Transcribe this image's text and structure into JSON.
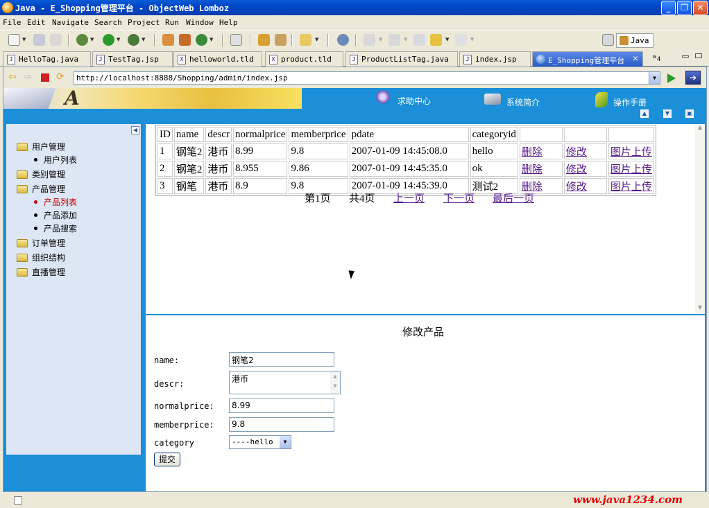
{
  "window": {
    "title": "Java - E_Shopping管理平台 - ObjectWeb Lomboz"
  },
  "menu": [
    "File",
    "Edit",
    "Navigate",
    "Search",
    "Project",
    "Run",
    "Window",
    "Help"
  ],
  "perspective": "Java",
  "tabs": [
    {
      "label": "HelloTag.java",
      "type": "J"
    },
    {
      "label": "TestTag.jsp",
      "type": "J"
    },
    {
      "label": "helloworld.tld",
      "type": "X"
    },
    {
      "label": "product.tld",
      "type": "X"
    },
    {
      "label": "ProductListTag.java",
      "type": "J"
    },
    {
      "label": "index.jsp",
      "type": "J"
    },
    {
      "label": "E_Shopping管理平台",
      "type": "web",
      "active": true
    }
  ],
  "tabs_more": "»",
  "tabs_more_count": "4",
  "browser": {
    "url": "http://localhost:8888/Shopping/admin/index.jsp"
  },
  "header": {
    "logo_letter": "A",
    "links": [
      "求助中心",
      "系统简介",
      "操作手册"
    ]
  },
  "sidebar": {
    "groups": [
      {
        "label": "用户管理",
        "items": [
          {
            "label": "用户列表"
          }
        ]
      },
      {
        "label": "类别管理",
        "items": []
      },
      {
        "label": "产品管理",
        "items": [
          {
            "label": "产品列表",
            "selected": true
          },
          {
            "label": "产品添加"
          },
          {
            "label": "产品搜索"
          }
        ]
      },
      {
        "label": "订单管理",
        "items": []
      },
      {
        "label": "组织结构",
        "items": []
      },
      {
        "label": "直播管理",
        "items": []
      }
    ]
  },
  "table": {
    "columns": [
      "ID",
      "name",
      "descr",
      "normalprice",
      "memberprice",
      "pdate",
      "categoryid"
    ],
    "rows": [
      {
        "cells": [
          "1",
          "钢笔2",
          "港币",
          "8.99",
          "9.8",
          "2007-01-09 14:45:08.0",
          "hello"
        ]
      },
      {
        "cells": [
          "2",
          "钢笔2",
          "港币",
          "8.955",
          "9.86",
          "2007-01-09 14:45:35.0",
          "ok"
        ]
      },
      {
        "cells": [
          "3",
          "钢笔",
          "港币",
          "8.9",
          "9.8",
          "2007-01-09 14:45:39.0",
          "测试2"
        ]
      }
    ],
    "actions": [
      "删除",
      "修改",
      "图片上传"
    ]
  },
  "pager": {
    "current": "第1页",
    "total": "共4页",
    "prev": "上一页",
    "next": "下一页",
    "last": "最后一页"
  },
  "form": {
    "title": "修改产品",
    "name_label": "name:",
    "name_value": "钢笔2",
    "descr_label": "descr:",
    "descr_value": "港币",
    "normalprice_label": "normalprice:",
    "normalprice_value": "8.99",
    "memberprice_label": "memberprice:",
    "memberprice_value": "9.8",
    "category_label": "category",
    "category_value": "----hello",
    "submit_label": "提交"
  },
  "watermark": "www.java1234.com",
  "colors": {
    "page_bg": "#1b8fd8",
    "link": "#551a8b",
    "selected": "#c00000",
    "sidebar": "#dde6f4"
  }
}
